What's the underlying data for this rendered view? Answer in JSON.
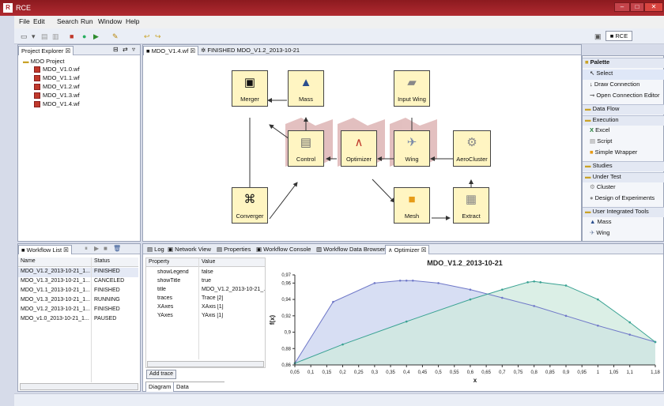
{
  "window": {
    "title": "RCE",
    "perspective": "RCE"
  },
  "menu": [
    "File",
    "Edit",
    "Search",
    "Run",
    "Window",
    "Help"
  ],
  "project_explorer": {
    "title": "Project Explorer",
    "project": "MDO Project",
    "files": [
      "MDO_V1.0.wf",
      "MDO_V1.1.wf",
      "MDO_V1.2.wf",
      "MDO_V1.3.wf",
      "MDO_V1.4.wf"
    ]
  },
  "editor": {
    "tabs": [
      "MDO_V1.4.wf",
      "FINISHED MDO_V1.2_2013-10-21"
    ],
    "nodes": {
      "merger": "Merger",
      "mass": "Mass",
      "input_wing": "Input Wing",
      "control": "Control",
      "optimizer": "Optimizer",
      "wing": "Wing",
      "aerocluster": "AeroCluster",
      "converger": "Converger",
      "mesh": "Mesh",
      "extract": "Extract"
    }
  },
  "palette": {
    "title": "Palette",
    "tools": [
      "Select",
      "Draw Connection",
      "Open Connection Editor"
    ],
    "groups": [
      {
        "name": "Data Flow",
        "items": []
      },
      {
        "name": "Execution",
        "items": [
          "Excel",
          "Script",
          "Simple Wrapper"
        ]
      },
      {
        "name": "Studies",
        "items": []
      },
      {
        "name": "Under Test",
        "items": [
          "Cluster",
          "Design of Experiments"
        ]
      },
      {
        "name": "User Integrated Tools",
        "items": [
          "Mass",
          "Wing"
        ]
      }
    ]
  },
  "workflow_list": {
    "title": "Workflow List",
    "columns": [
      "Name",
      "Status"
    ],
    "rows": [
      {
        "name": "MDO_V1.2_2013-10-21_1...",
        "status": "FINISHED"
      },
      {
        "name": "MDO_V1.3_2013-10-21_1...",
        "status": "CANCELED"
      },
      {
        "name": "MDO_V1.1_2013-10-21_1...",
        "status": "FINISHED"
      },
      {
        "name": "MDO_V1.3_2013-10-21_1...",
        "status": "RUNNING"
      },
      {
        "name": "MDO_V1.2_2013-10-21_1...",
        "status": "FINISHED"
      },
      {
        "name": "MDO_v1.0_2013-10-21_1...",
        "status": "PAUSED"
      }
    ]
  },
  "bottom_tabs": [
    "Log",
    "Network View",
    "Properties",
    "Workflow Console",
    "Workflow Data Browser",
    "Optimizer"
  ],
  "properties": {
    "columns": [
      "Property",
      "Value"
    ],
    "rows": [
      {
        "key": "showLegend",
        "value": "false"
      },
      {
        "key": "showTitle",
        "value": "true"
      },
      {
        "key": "title",
        "value": "MDO_V1.2_2013-10-21_..."
      },
      {
        "key": "traces",
        "value": "Trace [2]"
      },
      {
        "key": "XAxes",
        "value": "XAxis [1]"
      },
      {
        "key": "YAxes",
        "value": "YAxis [1]"
      }
    ],
    "add_trace_label": "Add trace",
    "subtabs": [
      "Diagram",
      "Data"
    ]
  },
  "chart_data": {
    "type": "area",
    "title": "MDO_V1.2_2013-10-21",
    "xlabel": "x",
    "ylabel": "f(x)",
    "xlim": [
      0.05,
      1.18
    ],
    "ylim": [
      0.86,
      0.97
    ],
    "xticks": [
      "0,05",
      "0,1",
      "0,15",
      "0,2",
      "0,25",
      "0,3",
      "0,35",
      "0,4",
      "0,45",
      "0,5",
      "0,55",
      "0,6",
      "0,65",
      "0,7",
      "0,75",
      "0,8",
      "0,85",
      "0,9",
      "0,95",
      "1",
      "1,05",
      "1,1",
      "1,18"
    ],
    "yticks": [
      "0,86",
      "0,88",
      "0,9",
      "0,92",
      "0,94",
      "0,96",
      "0,97"
    ],
    "series": [
      {
        "color": "#6f78c8",
        "fill": "#c9d3ef",
        "x": [
          0.05,
          0.17,
          0.3,
          0.38,
          0.4,
          0.42,
          0.5,
          0.6,
          0.7,
          0.8,
          0.9,
          1.0,
          1.1,
          1.18
        ],
        "y": [
          0.862,
          0.937,
          0.96,
          0.963,
          0.963,
          0.963,
          0.96,
          0.952,
          0.942,
          0.932,
          0.92,
          0.908,
          0.897,
          0.888
        ]
      },
      {
        "color": "#3aa293",
        "fill": "#cfeadd",
        "x": [
          0.05,
          0.2,
          0.4,
          0.6,
          0.7,
          0.78,
          0.8,
          0.82,
          0.9,
          1.0,
          1.1,
          1.18
        ],
        "y": [
          0.862,
          0.885,
          0.913,
          0.94,
          0.952,
          0.961,
          0.962,
          0.961,
          0.957,
          0.94,
          0.912,
          0.888
        ]
      }
    ]
  }
}
